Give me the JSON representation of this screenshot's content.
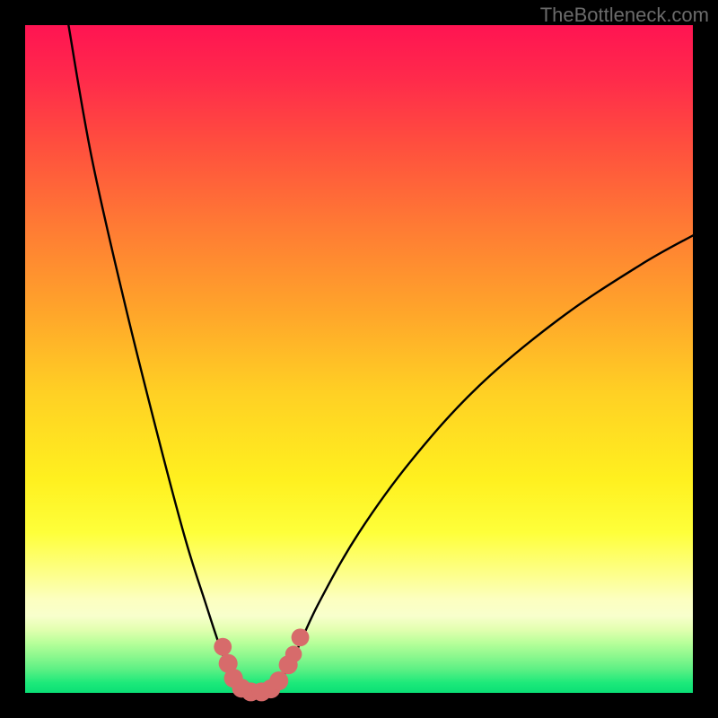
{
  "watermark": "TheBottleneck.com",
  "chart_data": {
    "type": "line",
    "title": "",
    "xlabel": "",
    "ylabel": "",
    "xlim": [
      0,
      100
    ],
    "ylim": [
      0,
      100
    ],
    "background": {
      "type": "vertical-gradient",
      "stops": [
        {
          "offset": 0.0,
          "color": "#ff1452"
        },
        {
          "offset": 0.08,
          "color": "#ff2a4b"
        },
        {
          "offset": 0.18,
          "color": "#ff4f3e"
        },
        {
          "offset": 0.3,
          "color": "#ff7a34"
        },
        {
          "offset": 0.42,
          "color": "#ffa22b"
        },
        {
          "offset": 0.55,
          "color": "#ffd024"
        },
        {
          "offset": 0.68,
          "color": "#fff01f"
        },
        {
          "offset": 0.76,
          "color": "#feff3a"
        },
        {
          "offset": 0.82,
          "color": "#fdff88"
        },
        {
          "offset": 0.86,
          "color": "#fcffc0"
        },
        {
          "offset": 0.885,
          "color": "#f8ffcc"
        },
        {
          "offset": 0.905,
          "color": "#e2ffb0"
        },
        {
          "offset": 0.925,
          "color": "#b8ff9a"
        },
        {
          "offset": 0.945,
          "color": "#8cf88e"
        },
        {
          "offset": 0.965,
          "color": "#5cf084"
        },
        {
          "offset": 0.985,
          "color": "#1de97a"
        },
        {
          "offset": 1.0,
          "color": "#0adf75"
        }
      ]
    },
    "series": [
      {
        "name": "bottleneck-curve",
        "points": [
          {
            "x": 6.5,
            "y": 100.0
          },
          {
            "x": 10.0,
            "y": 80.0
          },
          {
            "x": 15.0,
            "y": 58.0
          },
          {
            "x": 20.0,
            "y": 38.0
          },
          {
            "x": 24.0,
            "y": 23.0
          },
          {
            "x": 27.0,
            "y": 13.5
          },
          {
            "x": 29.5,
            "y": 6.0
          },
          {
            "x": 31.5,
            "y": 1.5
          },
          {
            "x": 33.5,
            "y": 0.0
          },
          {
            "x": 36.0,
            "y": 0.0
          },
          {
            "x": 38.0,
            "y": 1.5
          },
          {
            "x": 40.5,
            "y": 6.0
          },
          {
            "x": 44.0,
            "y": 13.5
          },
          {
            "x": 50.0,
            "y": 24.0
          },
          {
            "x": 58.0,
            "y": 35.0
          },
          {
            "x": 68.0,
            "y": 46.0
          },
          {
            "x": 80.0,
            "y": 56.0
          },
          {
            "x": 92.0,
            "y": 64.0
          },
          {
            "x": 100.0,
            "y": 68.5
          }
        ]
      }
    ],
    "markers": {
      "name": "highlight-dots",
      "color": "#d76b6b",
      "points": [
        {
          "x": 29.6,
          "y": 6.9,
          "r": 1.6
        },
        {
          "x": 30.4,
          "y": 4.4,
          "r": 1.7
        },
        {
          "x": 31.2,
          "y": 2.2,
          "r": 1.7
        },
        {
          "x": 32.4,
          "y": 0.7,
          "r": 1.7
        },
        {
          "x": 33.8,
          "y": 0.15,
          "r": 1.7
        },
        {
          "x": 35.4,
          "y": 0.15,
          "r": 1.7
        },
        {
          "x": 36.8,
          "y": 0.6,
          "r": 1.7
        },
        {
          "x": 38.0,
          "y": 1.8,
          "r": 1.7
        },
        {
          "x": 39.4,
          "y": 4.2,
          "r": 1.7
        },
        {
          "x": 40.2,
          "y": 5.8,
          "r": 1.5
        },
        {
          "x": 41.2,
          "y": 8.3,
          "r": 1.6
        }
      ]
    }
  }
}
